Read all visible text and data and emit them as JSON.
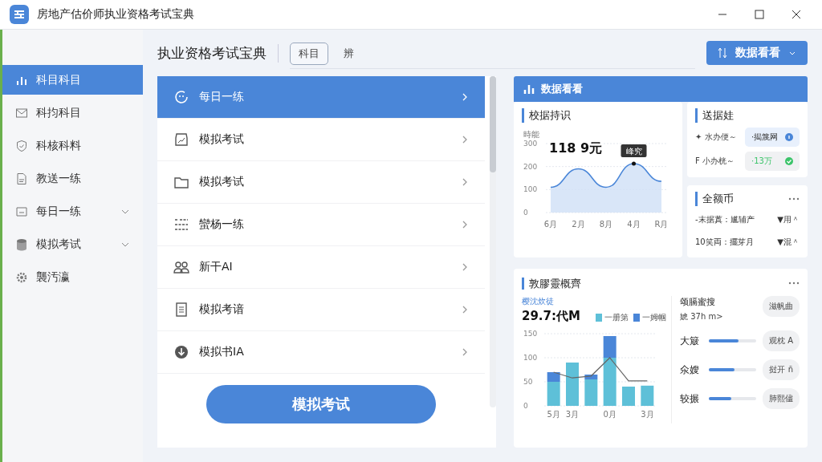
{
  "window": {
    "title": "房地产估价师执业资格考试宝典"
  },
  "sidebar": {
    "items": [
      {
        "label": "科目科目",
        "selected": true
      },
      {
        "label": "科抣科目",
        "selected": false
      },
      {
        "label": "科核科料",
        "selected": false
      },
      {
        "label": "教送一练",
        "selected": false
      },
      {
        "label": "每日一练",
        "selected": false,
        "expanded": false
      },
      {
        "label": "模拟考试",
        "selected": false,
        "expanded": false
      },
      {
        "label": "襲汚瀛",
        "selected": false
      }
    ]
  },
  "header": {
    "title": "执业资格考试宝典",
    "tabs": [
      {
        "label": "科目",
        "selected": true
      },
      {
        "label": "辨",
        "selected": false
      }
    ],
    "button": "数据看看"
  },
  "list": {
    "items": [
      {
        "label": "每日一练",
        "selected": true
      },
      {
        "label": "模拟考试",
        "selected": false
      },
      {
        "label": "模拟考试",
        "selected": false
      },
      {
        "label": "蠻杨一练",
        "selected": false
      },
      {
        "label": "新干AI",
        "selected": false
      },
      {
        "label": "模拟考谙",
        "selected": false
      },
      {
        "label": "模拟书IA",
        "selected": false
      }
    ],
    "button": "模拟考试"
  },
  "dashboard": {
    "title": "数据看看",
    "trend": {
      "title": "校据持识",
      "ylabel": "時能",
      "value": "118 9元",
      "chart_data": {
        "type": "area",
        "categories": [
          "6月",
          "2月",
          "8月",
          "4月",
          "R月"
        ],
        "values": [
          110,
          190,
          110,
          213,
          136
        ],
        "ylim": [
          0,
          300
        ],
        "yticks": [
          0,
          100,
          200,
          300
        ],
        "annotations": [
          {
            "x": "4月",
            "y": 213,
            "text": "峰究"
          }
        ]
      }
    },
    "status": {
      "title": "送据娃",
      "rows": [
        {
          "label": "✦ 水办便～",
          "value": "·揭篾网",
          "kind": "info"
        },
        {
          "label": "F 小办桄～",
          "value": "·13万",
          "kind": "ok"
        }
      ]
    },
    "ranking": {
      "title": "全额币",
      "rows": [
        {
          "label": "-末据蒖：尴辅产",
          "value": "▼用＾"
        },
        {
          "label": "10笑両：擺芽月",
          "value": "▼混＾"
        }
      ]
    },
    "overview": {
      "title": "敦膠靈概齊",
      "subtitle": "樱沈炊徒",
      "value": "29.7:代M",
      "chart_data": {
        "type": "bar",
        "stacked": true,
        "categories": [
          "5月",
          "3月",
          null,
          "0月",
          null,
          "3月"
        ],
        "series": [
          {
            "name": "一册第",
            "color": "#5ec0d8",
            "values": [
              50,
              90,
              55,
              100,
              40,
              42
            ]
          },
          {
            "name": "一姆帼",
            "color": "#4a86d8",
            "values": [
              20,
              0,
              10,
              45,
              0,
              0
            ]
          },
          {
            "type": "line",
            "color": "#666666",
            "values": [
              70,
              58,
              62,
              100,
              52,
              52
            ]
          }
        ],
        "ylim": [
          0,
          150
        ],
        "yticks": [
          0,
          50,
          100,
          150
        ]
      },
      "side_title": "颂膈蜜搜",
      "side_value": "婋 37h m>",
      "side_button": "滋帆曲",
      "metrics": [
        {
          "label": "大簸",
          "level": 0.63,
          "button": "观枕 A"
        },
        {
          "label": "氽嫂",
          "level": 0.53,
          "button": "挝开 ñ"
        },
        {
          "label": "较搌",
          "level": 0.47,
          "button": "肺熙儘"
        }
      ]
    }
  }
}
